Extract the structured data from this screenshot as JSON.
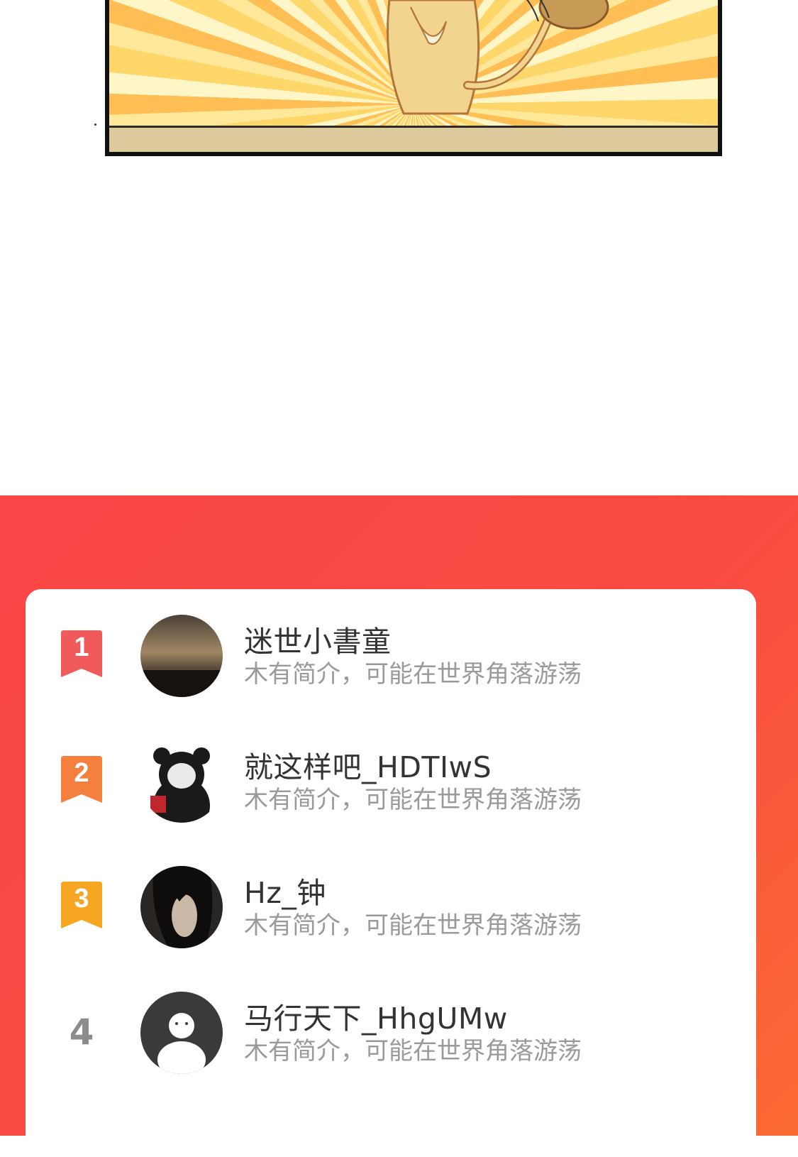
{
  "ranking": {
    "items": [
      {
        "rank": "1",
        "name": "迷世小書童",
        "intro": "木有简介，可能在世界角落游荡",
        "badge_color": "#f15a5a"
      },
      {
        "rank": "2",
        "name": "就这样吧_HDTIwS",
        "intro": "木有简介，可能在世界角落游荡",
        "badge_color": "#f57f3f"
      },
      {
        "rank": "3",
        "name": "Hz_钟",
        "intro": "木有简介，可能在世界角落游荡",
        "badge_color": "#f6a623"
      },
      {
        "rank": "4",
        "name": "马行天下_HhgUMw",
        "intro": "木有简介，可能在世界角落游荡",
        "badge_color": "#8c8c8c"
      }
    ]
  },
  "colors": {
    "section_bg": "#f84646",
    "card_bg": "#ffffff",
    "name_text": "#333333",
    "intro_text": "#9a9a9a"
  }
}
